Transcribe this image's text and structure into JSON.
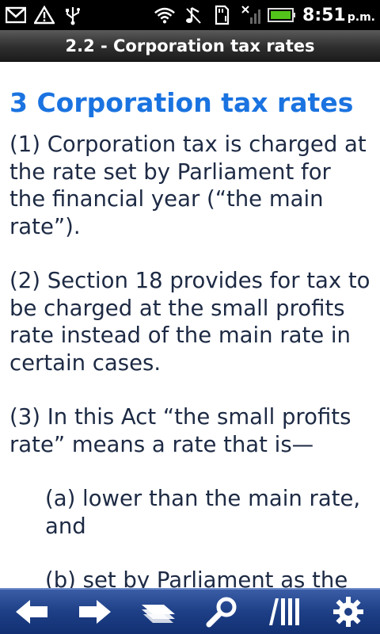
{
  "status_bar": {
    "left_icons": [
      "gmail-icon",
      "warning-icon",
      "usb-icon"
    ],
    "right_icons": [
      "wifi-icon",
      "music-icon",
      "sd-card-icon",
      "signal-icon",
      "battery-icon"
    ],
    "time": "8:51",
    "ampm": "p.m."
  },
  "title_bar": {
    "title": "2.2 - Corporation tax rates"
  },
  "content": {
    "heading": "3 Corporation tax rates",
    "paragraphs": [
      "(1) Corporation tax is charged at the rate set by Parliament for the financial year (“the main rate”).",
      "(2) Section 18 provides for tax to be charged at the small profits rate instead of the main rate in certain cases.",
      "(3) In this Act “the small profits rate” means a rate that is—",
      "(a) lower than the main rate, and",
      "(b) set by Parliament as the small profits rate."
    ]
  },
  "toolbar": {
    "buttons": [
      "back-arrow-icon",
      "forward-arrow-icon",
      "contents-icon",
      "search-icon",
      "library-icon",
      "settings-icon"
    ]
  },
  "colors": {
    "heading": "#1a73e0",
    "body_text": "#1d2a44",
    "toolbar": "#1e3f86"
  }
}
